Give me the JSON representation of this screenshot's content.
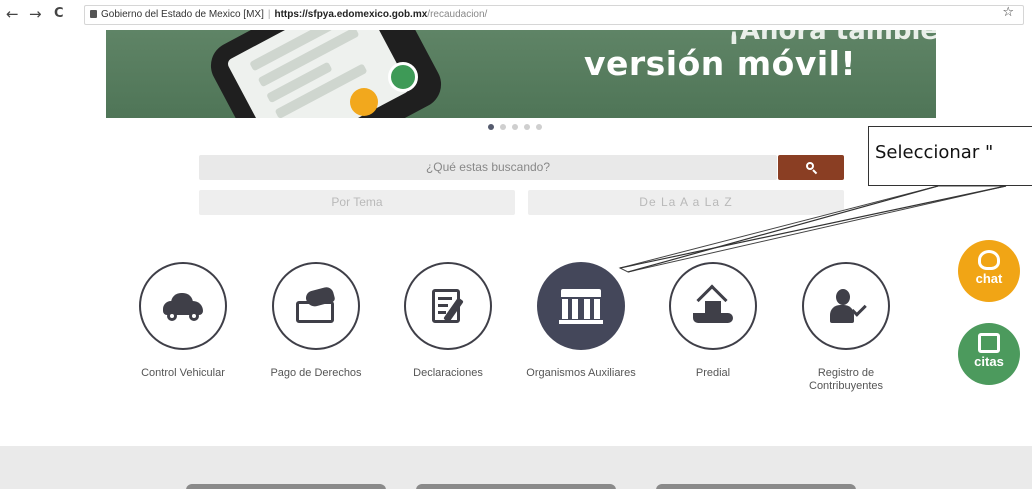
{
  "browser": {
    "back_icon": "←",
    "forward_icon": "→",
    "reload_icon": "C",
    "site_name": "Gobierno del Estado de Mexico [MX]",
    "url_domain": "https://sfpya.edomexico.gob.mx",
    "url_path": "/recaudacion/",
    "star_icon": "☆"
  },
  "banner": {
    "title": "versión móvil!",
    "title_top": "¡Ahora también"
  },
  "carousel": {
    "slides": 5,
    "active": 0
  },
  "search": {
    "placeholder": "¿Qué estas buscando?",
    "tabs": [
      "Por Tema",
      "De La A a La Z"
    ]
  },
  "callout": {
    "text": "Seleccionar \""
  },
  "floating": {
    "chat_label": "chat",
    "citas_label": "citas"
  },
  "categories": [
    {
      "label": "Control Vehicular",
      "icon": "car-icon"
    },
    {
      "label": "Pago de Derechos",
      "icon": "payment-card-icon"
    },
    {
      "label": "Declaraciones",
      "icon": "document-pen-icon"
    },
    {
      "label": "Organismos Auxiliares",
      "icon": "building-icon",
      "selected": true
    },
    {
      "label": "Predial",
      "icon": "house-hand-icon"
    },
    {
      "label": "Registro de\nContribuyentes",
      "icon": "person-check-icon"
    }
  ],
  "colors": {
    "banner": "#557b5d",
    "search_button": "#8a3e23",
    "selected_circle": "#44475a",
    "chat": "#f1a515",
    "citas": "#4c9a5d"
  }
}
